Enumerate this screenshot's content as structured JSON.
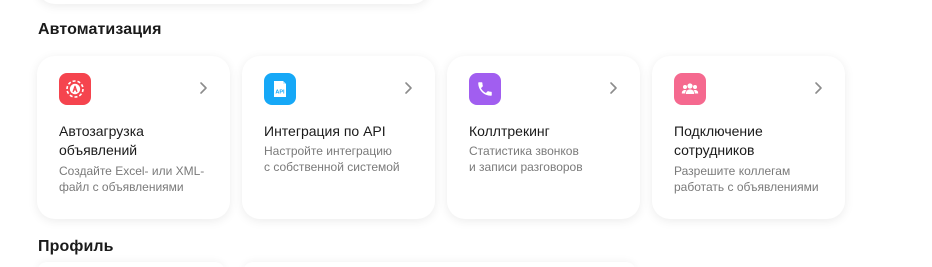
{
  "sections": {
    "automation_title": "Автоматизация",
    "profile_title": "Профиль"
  },
  "cards": [
    {
      "title": "Автозагрузка объявлений",
      "description": "Создайте Excel- или XML-\nфайл с объявлениями",
      "icon": "autoload-icon",
      "color": "#f5444e"
    },
    {
      "title": "Интеграция по API",
      "description": "Настройте интеграцию\nс собственной системой",
      "icon": "api-icon",
      "icon_label": "API",
      "color": "#16a8f7"
    },
    {
      "title": "Коллтрекинг",
      "description": "Статистика звонков\nи записи разговоров",
      "icon": "phone-icon",
      "color": "#a15ef0"
    },
    {
      "title": "Подключение сотрудников",
      "description": "Разрешите коллегам\nработать с объявлениями",
      "icon": "people-icon",
      "color": "#f5698f"
    }
  ],
  "colors": {
    "text_primary": "#1a1a1a",
    "text_secondary": "#7a7a7a",
    "chevron": "#8c8c8c"
  }
}
